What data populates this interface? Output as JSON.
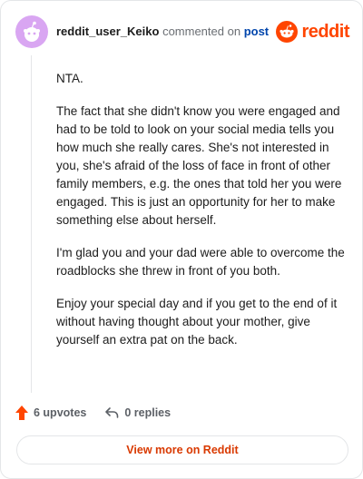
{
  "comment": {
    "username": "reddit_user_Keiko",
    "action_text": "commented on",
    "post_link_text": "post",
    "paragraphs": [
      "NTA.",
      "The fact that she didn't know you were engaged and had to be told to look on your social media tells you how much she really cares. She's not interested in you, she's afraid of the loss of face in front of other family members, e.g. the ones that told her you were engaged. This is just an opportunity for her to make something else about herself.",
      "I'm glad you and your dad were able to overcome the roadblocks she threw in front of you both.",
      "Enjoy your special day and if you get to the end of it without having thought about your mother, give yourself an extra pat on the back."
    ]
  },
  "logo": {
    "text": "reddit",
    "icon": "reddit-snoo-icon"
  },
  "footer": {
    "upvotes_label": "6 upvotes",
    "replies_label": "0 replies",
    "upvote_icon": "upvote-arrow-icon",
    "reply_icon": "reply-arrow-icon"
  },
  "view_more_label": "View more on Reddit",
  "colors": {
    "brand": "#ff4500",
    "avatar_bg": "#d9a6f2",
    "link": "#0045ac",
    "view_more_text": "#d93900"
  }
}
